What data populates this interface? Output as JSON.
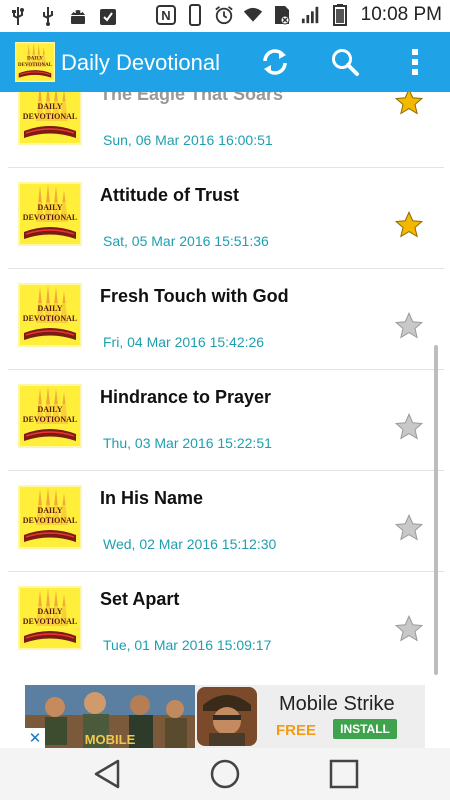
{
  "status_bar": {
    "time": "10:08 PM",
    "left_icons": [
      "usb-icon",
      "usb-debug-icon",
      "android-icon",
      "clipboard-icon"
    ],
    "right_icons": [
      "nfc-icon",
      "vibrate-icon",
      "alarm-icon",
      "wifi-icon",
      "sim-icon",
      "signal-icon",
      "battery-icon"
    ]
  },
  "app_bar": {
    "title": "Daily Devotional",
    "logo_text_1": "DAILY",
    "logo_text_2": "DEVOTIONAL",
    "actions": [
      "refresh-icon",
      "search-icon",
      "overflow-menu-icon"
    ],
    "color": "#1fa3e6"
  },
  "devotionals": [
    {
      "title": "The Eagle That Soars",
      "date": "Sun, 06 Mar 2016 16:00:51",
      "favorite": true
    },
    {
      "title": "Attitude of Trust",
      "date": "Sat, 05 Mar 2016 15:51:36",
      "favorite": true
    },
    {
      "title": "Fresh Touch with God",
      "date": "Fri, 04 Mar 2016 15:42:26",
      "favorite": false
    },
    {
      "title": "Hindrance to Prayer",
      "date": "Thu, 03 Mar 2016 15:22:51",
      "favorite": false
    },
    {
      "title": "In His Name",
      "date": "Wed, 02 Mar 2016 15:12:30",
      "favorite": false
    },
    {
      "title": "Set Apart",
      "date": "Tue, 01 Mar 2016 15:09:17",
      "favorite": false
    }
  ],
  "thumb_text_1": "DAILY",
  "thumb_text_2": "DEVOTIONAL",
  "ad": {
    "title": "Mobile Strike",
    "price": "FREE",
    "install_label": "INSTALL",
    "banner_text": "MOBILE",
    "close_label": "✕"
  },
  "nav_bar": [
    "back-icon",
    "home-icon",
    "recents-icon"
  ],
  "colors": {
    "accent": "#1fa3e6",
    "date": "#1e9fb0",
    "star_on": "#f5b800",
    "star_off": "#c4c4c4",
    "install": "#3fa34d",
    "free": "#f39c12"
  }
}
